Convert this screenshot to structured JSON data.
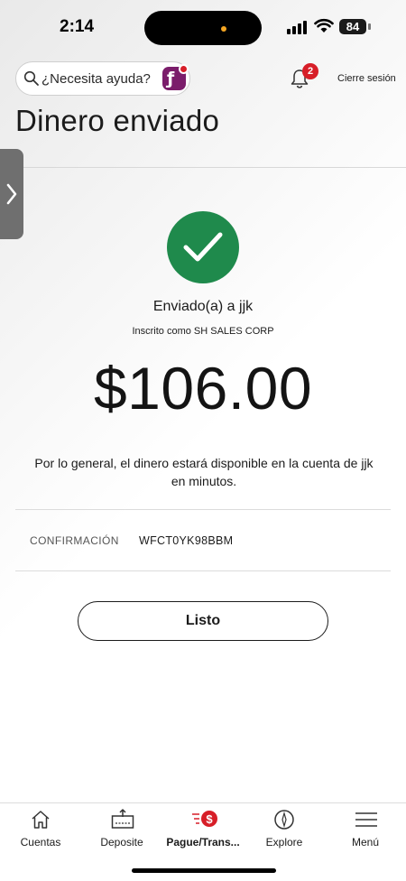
{
  "status_bar": {
    "time": "2:14",
    "battery": "84"
  },
  "header": {
    "search_placeholder": "¿Necesita ayuda?",
    "notification_count": "2",
    "logout_label": "Cierre sesión"
  },
  "page": {
    "title": "Dinero enviado"
  },
  "result": {
    "sent_to": "Enviado(a) a jjk",
    "registered_as": "Inscrito como SH SALES CORP",
    "amount": "$106.00",
    "availability_note": "Por lo general, el dinero estará disponible en la cuenta de jjk en minutos.",
    "confirmation_label": "CONFIRMACIÓN",
    "confirmation_value": "WFCT0YK98BBM",
    "done_label": "Listo"
  },
  "bottom_nav": {
    "items": [
      {
        "label": "Cuentas",
        "icon": "home-icon"
      },
      {
        "label": "Deposite",
        "icon": "deposit-icon"
      },
      {
        "label": "Pague/Trans...",
        "icon": "pay-transfer-icon",
        "active": true
      },
      {
        "label": "Explore",
        "icon": "compass-icon"
      },
      {
        "label": "Menú",
        "icon": "menu-icon"
      }
    ]
  },
  "colors": {
    "success": "#1f8a4c",
    "badge": "#d71e28",
    "brand_purple": "#7b1d6b"
  }
}
